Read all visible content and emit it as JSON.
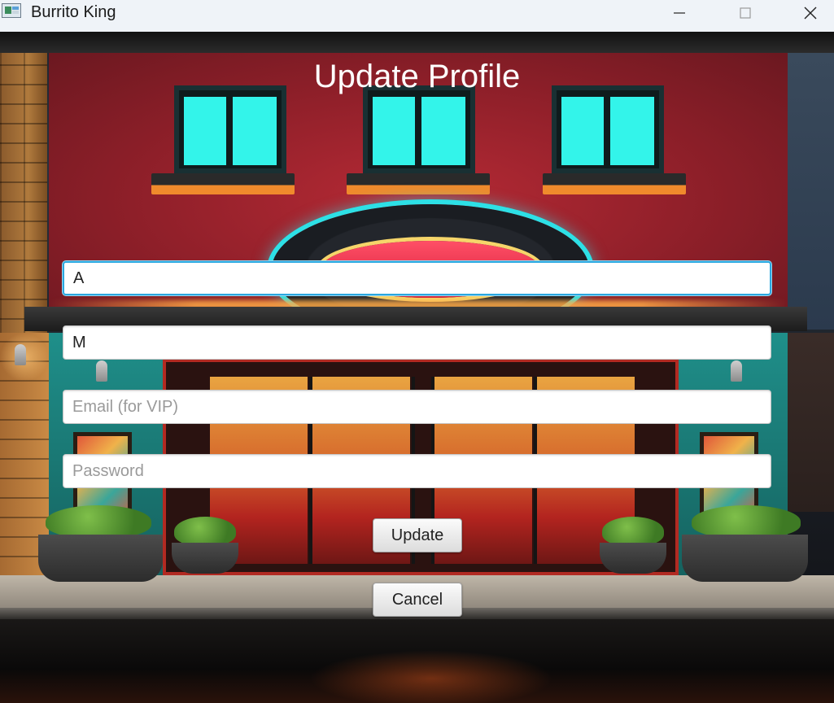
{
  "window": {
    "title": "Burrito King",
    "icon": "app-window-icon",
    "controls": [
      "minimize-icon",
      "maximize-icon",
      "close-icon"
    ]
  },
  "form": {
    "title": "Update Profile",
    "first_name": {
      "value": "A",
      "placeholder": ""
    },
    "last_name": {
      "value": "M",
      "placeholder": ""
    },
    "email": {
      "value": "",
      "placeholder": "Email (for VIP)"
    },
    "password": {
      "value": "",
      "placeholder": "Password"
    },
    "update_label": "Update",
    "cancel_label": "Cancel"
  },
  "colors": {
    "focus_border": "#2ba8e0",
    "title_text": "#ffffff",
    "facade_red": "#b62a35",
    "window_cyan": "#33f4ea"
  }
}
